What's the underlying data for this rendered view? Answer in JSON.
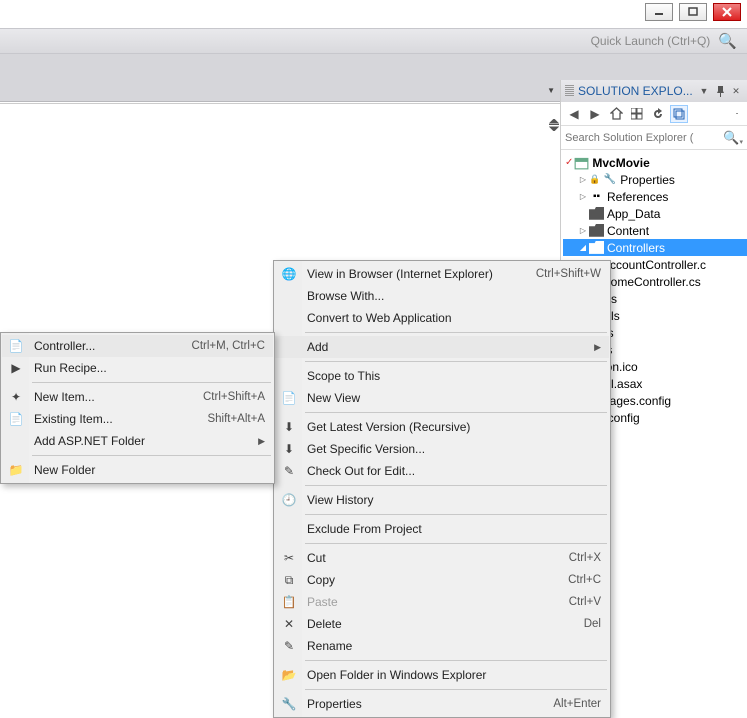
{
  "window": {
    "quick_launch_placeholder": "Quick Launch (Ctrl+Q)"
  },
  "solution_explorer": {
    "title": "SOLUTION EXPLO...",
    "search_placeholder": "Search Solution Explorer (",
    "project": "MvcMovie",
    "items": {
      "properties": "Properties",
      "references": "References",
      "app_data": "App_Data",
      "content": "Content",
      "controllers": "Controllers",
      "account_controller": "AccountController.c",
      "home_controller": "HomeController.cs",
      "ages": "ages",
      "odels": "odels",
      "ripts": "ripts",
      "ews": "ews",
      "favicon": "vicon.ico",
      "global": "obal.asax",
      "packages": "ackages.config",
      "webconfig": "eb.config"
    }
  },
  "context_main": {
    "view_browser": "View in Browser (Internet Explorer)",
    "view_browser_key": "Ctrl+Shift+W",
    "browse_with": "Browse With...",
    "convert": "Convert to Web Application",
    "add": "Add",
    "scope": "Scope to This",
    "new_view": "New View",
    "get_latest": "Get Latest Version (Recursive)",
    "get_specific": "Get Specific Version...",
    "check_out": "Check Out for Edit...",
    "view_history": "View History",
    "exclude": "Exclude From Project",
    "cut": "Cut",
    "cut_key": "Ctrl+X",
    "copy": "Copy",
    "copy_key": "Ctrl+C",
    "paste": "Paste",
    "paste_key": "Ctrl+V",
    "delete": "Delete",
    "delete_key": "Del",
    "rename": "Rename",
    "open_folder": "Open Folder in Windows Explorer",
    "properties": "Properties",
    "properties_key": "Alt+Enter"
  },
  "context_sub": {
    "controller": "Controller...",
    "controller_key": "Ctrl+M, Ctrl+C",
    "run_recipe": "Run Recipe...",
    "new_item": "New Item...",
    "new_item_key": "Ctrl+Shift+A",
    "existing_item": "Existing Item...",
    "existing_item_key": "Shift+Alt+A",
    "add_aspnet": "Add ASP.NET Folder",
    "new_folder": "New Folder"
  }
}
